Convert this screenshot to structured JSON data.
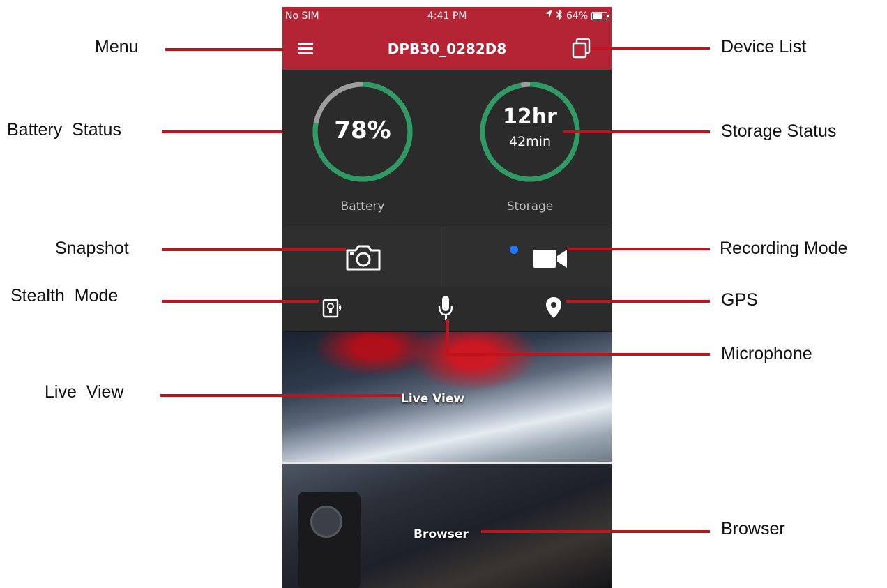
{
  "status_bar": {
    "carrier": "No SIM",
    "time": "4:41 PM",
    "battery_pct": "64%"
  },
  "app_bar": {
    "title": "DPB30_0282D8"
  },
  "battery": {
    "value": "78%",
    "label": "Battery",
    "fraction": 0.78
  },
  "storage": {
    "hours": "12hr",
    "minutes": "42min",
    "label": "Storage",
    "fraction": 0.97
  },
  "tiles": {
    "live_view": "Live View",
    "browser": "Browser"
  },
  "callouts": {
    "menu": "Menu",
    "device_list": "Device List",
    "battery_status": "Battery  Status",
    "storage_status": "Storage Status",
    "snapshot": "Snapshot",
    "recording_mode": "Recording Mode",
    "stealth_mode": "Stealth  Mode",
    "gps": "GPS",
    "microphone": "Microphone",
    "live_view": "Live  View",
    "browser": "Browser"
  },
  "colors": {
    "accent": "#b52434",
    "gauge_ring": "#2e9b62",
    "gauge_track": "#9e9e9e",
    "callout_line": "#c0141c",
    "record_dot": "#1e7bff"
  },
  "icons": [
    "menu-icon",
    "device-list-icon",
    "camera-icon",
    "video-camera-icon",
    "stealth-mode-icon",
    "microphone-icon",
    "location-pin-icon",
    "location-arrow-icon",
    "bluetooth-icon",
    "battery-icon"
  ]
}
